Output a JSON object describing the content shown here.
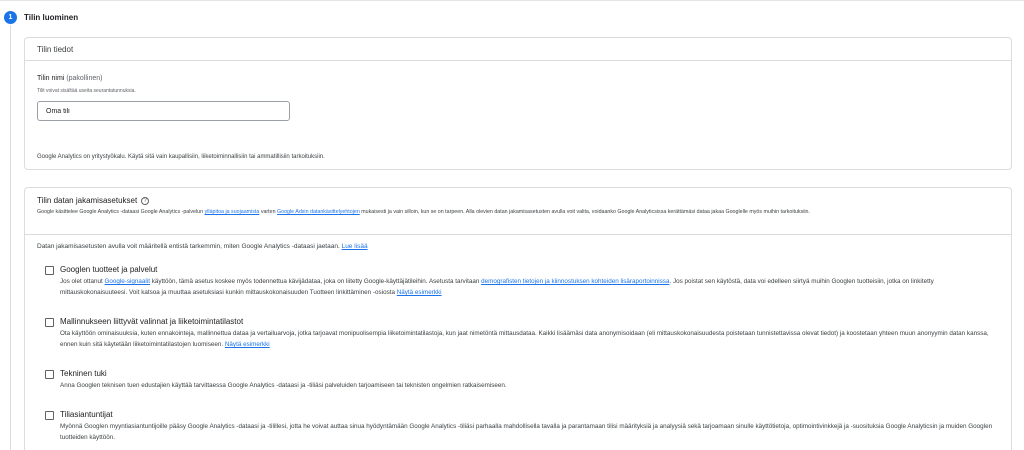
{
  "step": {
    "number": "1",
    "title": "Tilin luominen"
  },
  "account_details": {
    "header": "Tilin tiedot",
    "name_label": "Tilin nimi",
    "name_required": "(pakollinen)",
    "name_hint": "Tilit voivat sisältää useita seurantatunnuksia.",
    "name_value": "Oma tili",
    "note": "Google Analytics on yritystyökalu. Käytä sitä vain kaupallisiin, liiketoiminnallisiin tai ammatillisiin tarkoituksiin."
  },
  "data_sharing": {
    "title": "Tilin datan jakamisasetukset",
    "desc_1": "Google käsittelee Google Analytics -dataasi Google Analytics -palvelun",
    "desc_link_1": "ylläpitoa ja suojaamista",
    "desc_2": "varten",
    "desc_link_2": "Google Adsin datankäsittelyehtojen",
    "desc_3": "mukaisesti ja vain silloin, kun se on tarpeen. Alla olevien datan jakamisasetusten avulla voit valita, voidaanko Google Analyticsissa kerättämäsi dataa jakaa Googlelle myös muihin tarkoituksiin.",
    "intro_text": "Datan jakamisasetusten avulla voit määritellä entistä tarkemmin, miten Google Analytics -dataasi jaetaan.",
    "intro_link": "Lue lisää",
    "options": [
      {
        "title": "Googlen tuotteet ja palvelut",
        "d1": "Jos olet ottanut",
        "link1": "Google-signaalit",
        "d2": "käyttöön, tämä asetus koskee myös todennettua kävijädataa, joka on liitetty Google-käyttäjätileihin. Asetusta tarvitaan",
        "link2": "demografisten tietojen ja kiinnostuksen kohteiden lisäraportoinnissa",
        "d3": ". Jos poistat sen käytöstä, data voi edelleen siirtyä muihin Googlen tuotteisiin, jotka on linkitetty mittauskokonaisuuteesi. Voit katsoa ja muuttaa asetuksiasi kunkin mittauskokonaisuuden Tuotteen linkittäminen -osiosta",
        "link3": "Näytä esimerkki"
      },
      {
        "title": "Mallinnukseen liittyvät valinnat ja liiketoimintatilastot",
        "d1": "Ota käyttöön ominaisuuksia, kuten ennakointeja, mallinnettua dataa ja vertailuarvoja, jotka tarjoavat monipuolisempia liiketoimintatilastoja, kun jaat nimetöntä mittausdataa. Kaikki lisäämäsi data anonymisoidaan (eli mittauskokonaisuudesta poistetaan tunnistettavissa olevat tiedot) ja koostetaan yhteen muun anonyymin datan kanssa, ennen kuin sitä käytetään liiketoimintatilastojen luomiseen.",
        "link1": "Näytä esimerkki"
      },
      {
        "title": "Tekninen tuki",
        "d1": "Anna Googlen teknisen tuen edustajien käyttää tarvittaessa Google Analytics -dataasi ja -tiliäsi palveluiden tarjoamiseen tai teknisten ongelmien ratkaisemiseen."
      },
      {
        "title": "Tiliasiantuntijat",
        "d1": "Myönnä Googlen myyntiasiantuntijoille pääsy Google Analytics -dataasi ja -tilillesi, jotta he voivat auttaa sinua hyödyntämään Google Analytics -tiliäsi parhaalla mahdollisella tavalla ja parantamaan tilisi määrityksiä ja analyysiä sekä tarjoamaan sinulle käyttötietoja, optimointivinkkejä ja -suosituksia Google Analyticsin ja muiden Googlen tuotteiden käyttöön."
      }
    ]
  }
}
